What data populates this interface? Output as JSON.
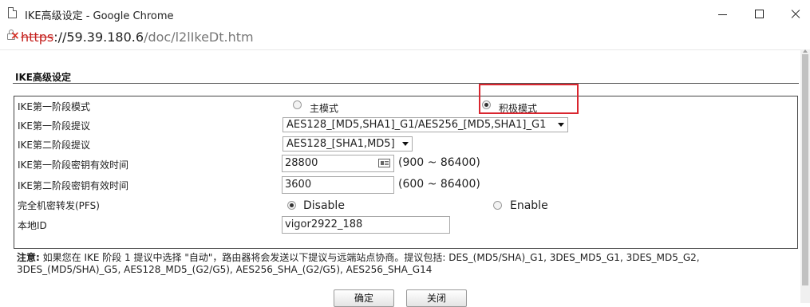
{
  "window": {
    "title": "IKE高级设定 - Google Chrome",
    "url_scheme": "https",
    "url_host": "://59.39.180.6",
    "url_path": "/doc/l2lIkeDt.htm"
  },
  "page": {
    "section_title": "IKE高级设定",
    "rows": {
      "phase1_mode": {
        "label": "IKE第一阶段模式",
        "options": [
          "主模式",
          "积极模式"
        ],
        "selected": "积极模式"
      },
      "phase1_proposal": {
        "label": "IKE第一阶段提议",
        "value": "AES128_[MD5,SHA1]_G1/AES256_[MD5,SHA1]_G1"
      },
      "phase2_proposal": {
        "label": "IKE第二阶段提议",
        "value": "AES128_[SHA1,MD5]"
      },
      "phase1_lifetime": {
        "label": "IKE第一阶段密钥有效时间",
        "value": "28800",
        "range": "(900 ~ 86400)"
      },
      "phase2_lifetime": {
        "label": "IKE第二阶段密钥有效时间",
        "value": "3600",
        "range": "(600 ~ 86400)"
      },
      "pfs": {
        "label": "完全机密转发(PFS)",
        "options": [
          "Disable",
          "Enable"
        ],
        "selected": "Disable"
      },
      "local_id": {
        "label": "本地ID",
        "value": "vigor2922_188"
      }
    },
    "note_prefix": "注意:",
    "note_text": " 如果您在 IKE 阶段 1 提议中选择 \"自动\"，路由器将会发送以下提议与远端站点协商。提议包括: DES_(MD5/SHA)_G1, 3DES_MD5_G1, 3DES_MD5_G2, 3DES_(MD5/SHA)_G5, AES128_MD5_(G2/G5), AES256_SHA_(G2/G5), AES256_SHA_G14",
    "ok_label": "确定",
    "close_label": "关闭"
  },
  "colors": {
    "highlight": "#d9262f",
    "insecure_scheme": "#c5221f"
  }
}
